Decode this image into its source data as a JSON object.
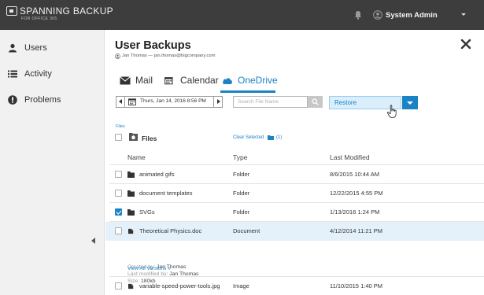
{
  "app": {
    "brand_name": "SPANNING BACKUP",
    "brand_sub": "FOR OFFICE 365",
    "user_name": "System Admin"
  },
  "sidebar": {
    "items": [
      {
        "label": "Users",
        "icon": "user-icon"
      },
      {
        "label": "Activity",
        "icon": "list-icon"
      },
      {
        "label": "Problems",
        "icon": "alert-icon"
      }
    ]
  },
  "header": {
    "title": "User Backups",
    "subtitle": "Jan Thomas — jan.thomas@bigcompany.com"
  },
  "tabs": [
    {
      "label": "Mail",
      "icon": "mail-icon"
    },
    {
      "label": "Calendar",
      "icon": "calendar-icon"
    },
    {
      "label": "OneDrive",
      "icon": "cloud-icon",
      "active": true
    }
  ],
  "toolbar": {
    "date": "Thurs, Jan 14, 2016 8:56 PM",
    "search_placeholder": "Search File Name",
    "restore_label": "Restore"
  },
  "breadcrumb": "Files",
  "files_header": {
    "label": "Files",
    "clear_selected": "Clear Selected",
    "selected_count": "(1)"
  },
  "columns": {
    "name": "Name",
    "type": "Type",
    "modified": "Last Modified"
  },
  "rows": [
    {
      "name": "animated gifs",
      "type": "Folder",
      "modified": "8/6/2015 10:44 AM",
      "icon": "folder-icon",
      "checked": false
    },
    {
      "name": "document templates",
      "type": "Folder",
      "modified": "12/22/2015 4:55 PM",
      "icon": "folder-icon",
      "checked": false
    },
    {
      "name": "SVGs",
      "type": "Folder",
      "modified": "1/13/2016 1:24 PM",
      "icon": "folder-icon",
      "checked": true
    },
    {
      "name": "Theoretical Physics.doc",
      "type": "Document",
      "modified": "4/12/2014 11:21 PM",
      "icon": "document-icon",
      "checked": false
    },
    {
      "name": "variable-speed-power-tools.jpg",
      "type": "Image",
      "modified": "11/10/2015 1:40 PM",
      "icon": "document-icon",
      "checked": false
    }
  ],
  "details": {
    "created_label": "Created by:",
    "created_value": "Jan Thomas",
    "modified_label": "Last modified by:",
    "modified_value": "Jan Thomas",
    "size_label": "Size:",
    "size_value": "180kb",
    "versions_link": "View All Versions »"
  },
  "colors": {
    "accent": "#1b82c6",
    "topbar": "#3d3d3d",
    "sidebar": "#f1f1f1",
    "highlight_row": "#e4f1fb"
  }
}
